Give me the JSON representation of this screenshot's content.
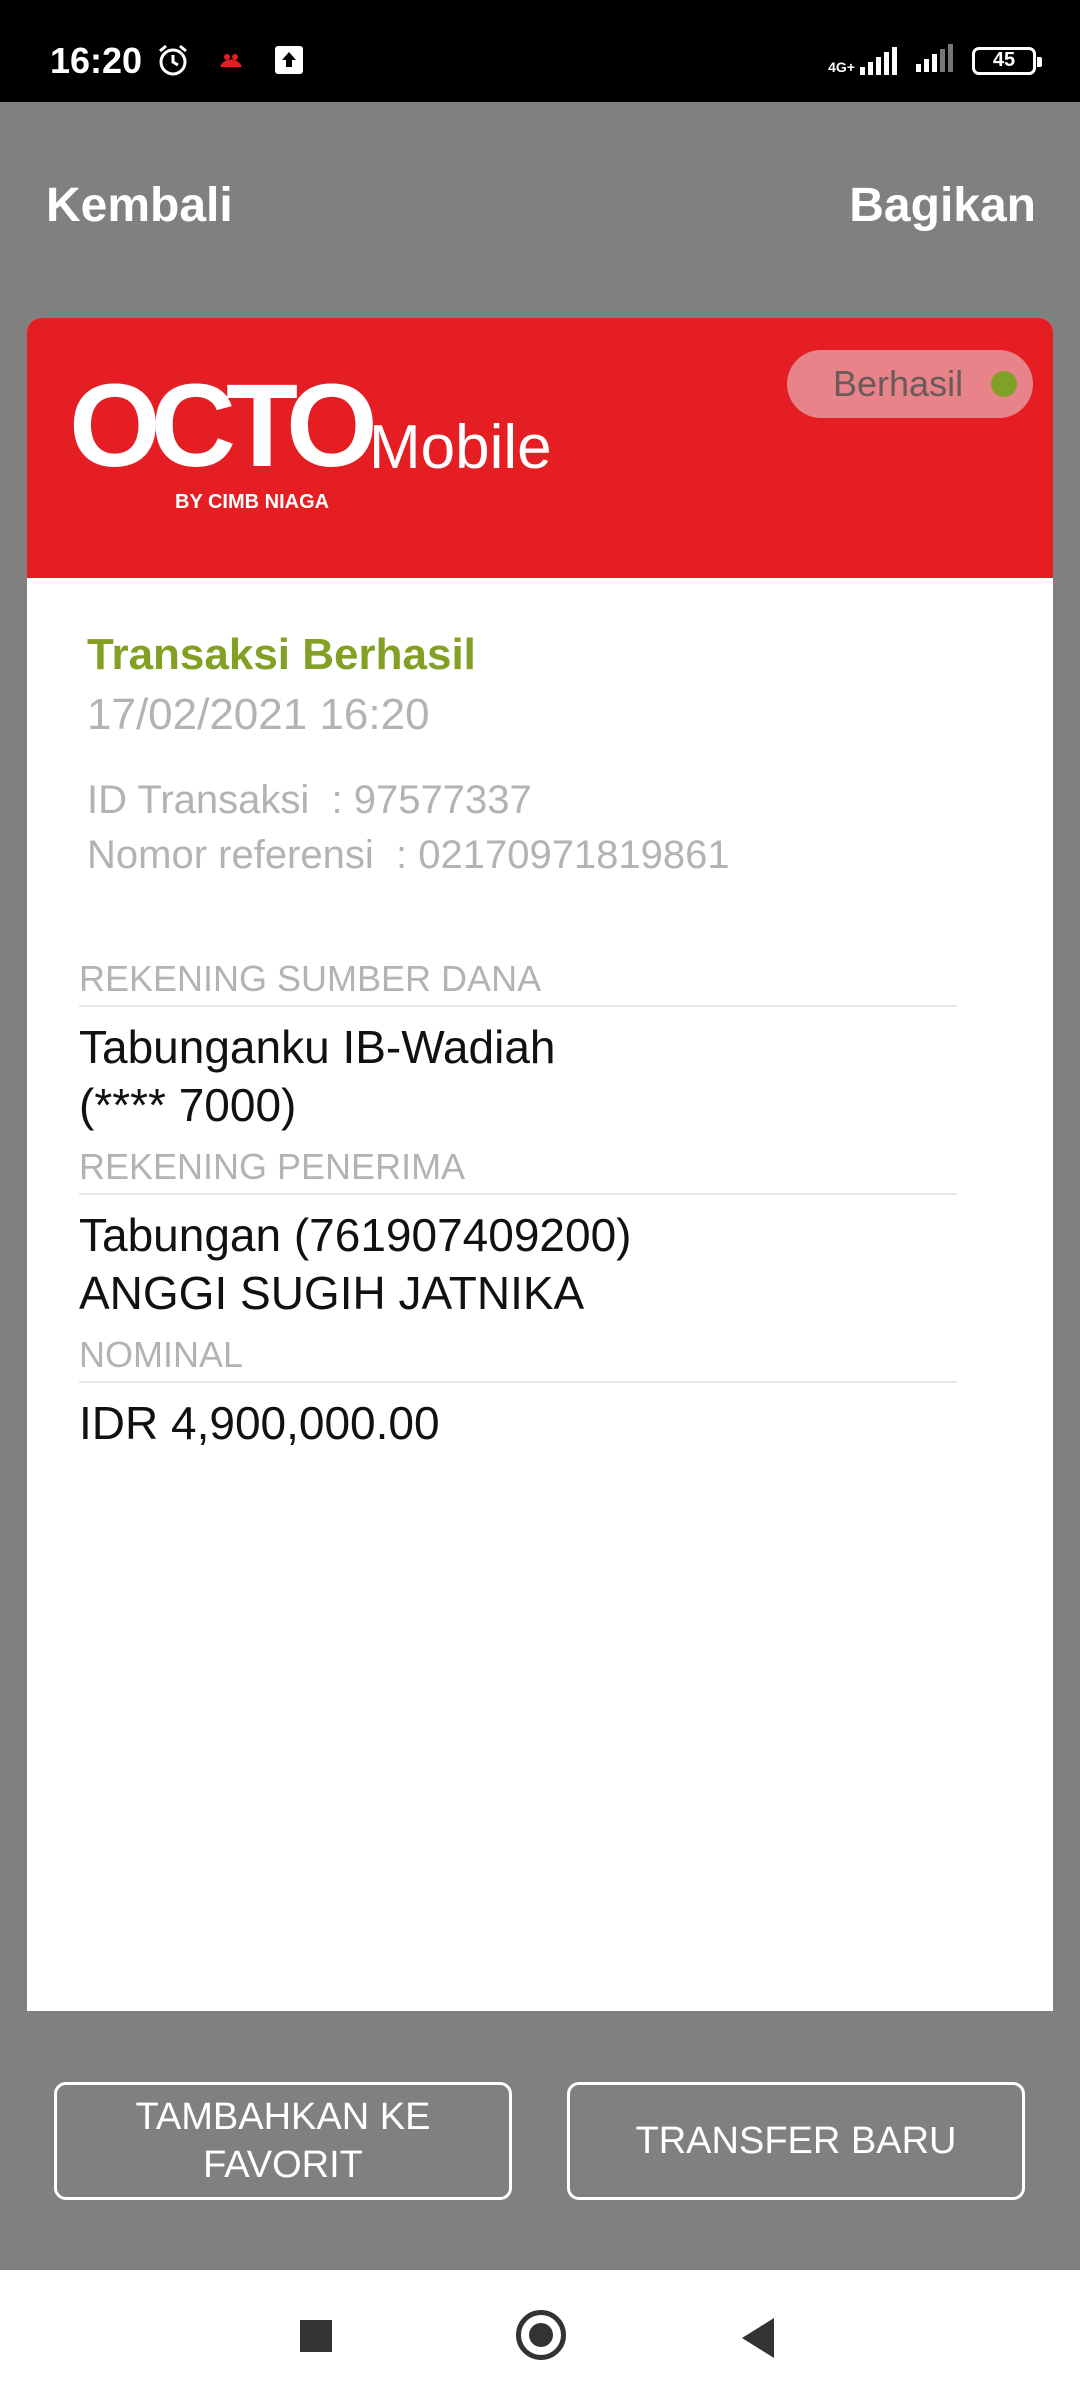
{
  "status_bar": {
    "time": "16:20",
    "network_label": "4G+",
    "battery_level": "45",
    "icons": [
      "alarm-icon",
      "notification-icon",
      "upload-icon",
      "signal-icon",
      "signal-icon",
      "battery-icon"
    ]
  },
  "header": {
    "back_label": "Kembali",
    "share_label": "Bagikan"
  },
  "brand": {
    "logo_text": "OCTO",
    "logo_suffix": "Mobile",
    "logo_byline": "BY CIMB NIAGA",
    "header_color": "#e41e22"
  },
  "status": {
    "label": "Berhasil",
    "dot_color": "#7fa226"
  },
  "transaction": {
    "title": "Transaksi Berhasil",
    "datetime": "17/02/2021 16:20",
    "id_line": "ID Transaksi  : 97577337",
    "ref_line": "Nomor referensi  : 02170971819861"
  },
  "sections": {
    "source_label": "REKENING SUMBER DANA",
    "source_line1": "Tabunganku IB-Wadiah",
    "source_line2": "(**** 7000)",
    "recipient_label": "REKENING PENERIMA",
    "recipient_line1": "Tabungan (761907409200)",
    "recipient_line2": "ANGGI SUGIH JATNIKA",
    "amount_label": "NOMINAL",
    "amount_value": "IDR 4,900,000.00"
  },
  "actions": {
    "favorite_line1": "TAMBAHKAN KE",
    "favorite_line2": "FAVORIT",
    "new_transfer": "TRANSFER BARU"
  }
}
